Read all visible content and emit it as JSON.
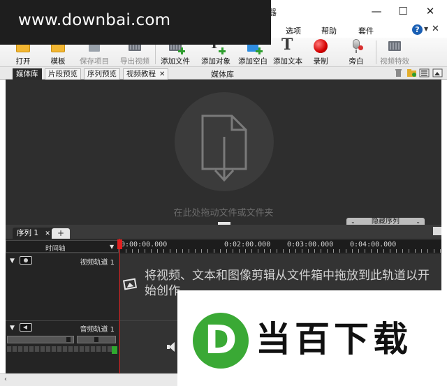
{
  "window": {
    "title_fragment": "器",
    "controls": {
      "minimize": "—",
      "maximize": "☐",
      "close": "✕"
    }
  },
  "menu": {
    "items": [
      "选项",
      "帮助",
      "套件"
    ],
    "help_glyph": "?",
    "close": "✕"
  },
  "toolbar": {
    "buttons": [
      {
        "label": "打开",
        "icon": "folder-open-icon",
        "enabled": true
      },
      {
        "label": "模板",
        "icon": "folder-template-icon",
        "enabled": true
      },
      {
        "label": "保存项目",
        "icon": "save-icon",
        "enabled": false
      },
      {
        "label": "导出视频",
        "icon": "export-video-icon",
        "enabled": false
      },
      {
        "label": "添加文件",
        "icon": "add-file-icon",
        "enabled": true
      },
      {
        "label": "添加对象",
        "icon": "add-object-icon",
        "enabled": true
      },
      {
        "label": "添加空白",
        "icon": "add-blank-icon",
        "enabled": true
      },
      {
        "label": "添加文本",
        "icon": "add-text-icon",
        "enabled": true
      },
      {
        "label": "录制",
        "icon": "record-icon",
        "enabled": true
      },
      {
        "label": "旁白",
        "icon": "narration-mic-icon",
        "enabled": true
      },
      {
        "label": "视频特效",
        "icon": "video-effects-icon",
        "enabled": false
      }
    ],
    "add_text_glyph": "T"
  },
  "media_tabs": {
    "tabs": [
      "媒体库",
      "片段预览",
      "序列预览",
      "视频教程"
    ],
    "active_index": 0,
    "closable_tab": "视频教程",
    "close_glyph": "✕",
    "panel_title": "媒体库"
  },
  "media_library": {
    "drop_hint": "在此处拖动文件或文件夹",
    "hide_sequence_label": "隐藏序列",
    "chevron": "⌄"
  },
  "sequence": {
    "tab_label": "序列 1",
    "close_glyph": "✕",
    "add_glyph": "+"
  },
  "timeline": {
    "ruler_label": "时间轴",
    "timecodes": [
      "0:00:00.000",
      "0:02:00.000",
      "0:03:00.000",
      "0:04:00.000"
    ],
    "video_track": {
      "name": "视频轨道 1",
      "hint": "将视频、文本和图像剪辑从文件箱中拖放到此轨道以开始创作。"
    },
    "audio_track": {
      "name": "音频轨道 1"
    },
    "scroll_left": "‹"
  },
  "watermarks": {
    "site_url": "www.downbai.com",
    "logo_letter": "D",
    "brand_name": "当百下载",
    "logo_color": "#3aa935"
  }
}
